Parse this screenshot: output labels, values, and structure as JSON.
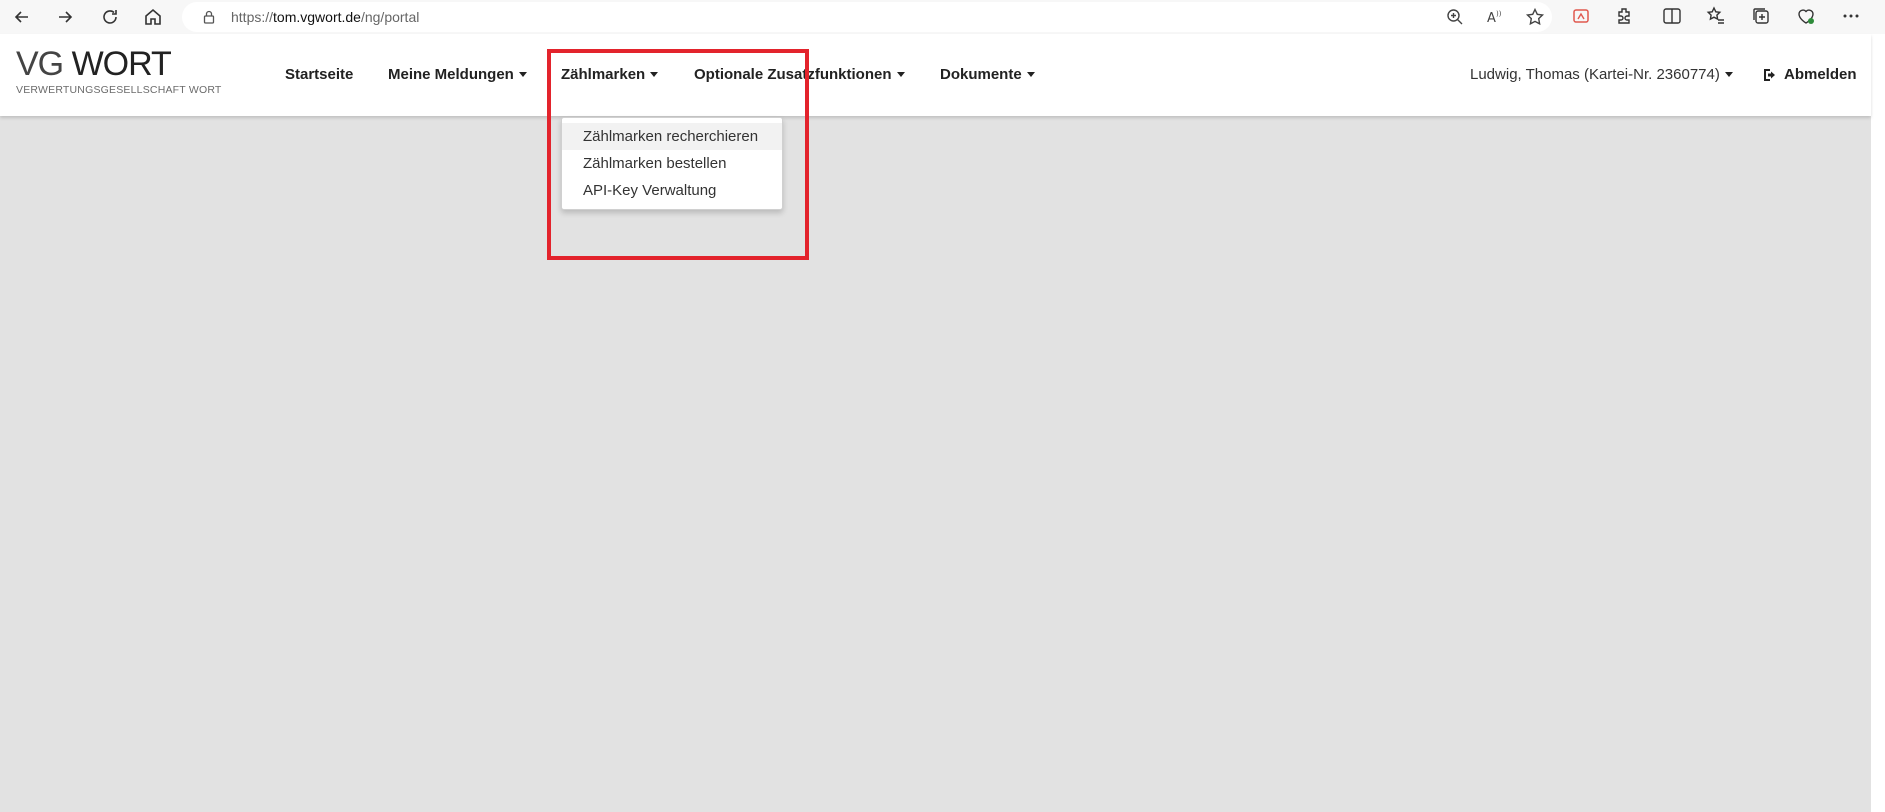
{
  "browser": {
    "url_scheme": "https://",
    "url_host": "tom.vgwort.de",
    "url_path": "/ng/portal",
    "back_icon": "arrow-left-icon",
    "forward_icon": "arrow-right-icon",
    "refresh_icon": "refresh-icon",
    "home_icon": "home-icon"
  },
  "logo": {
    "vg": "VG",
    "wort": "WORT",
    "subtitle": "VERWERTUNGSGESELLSCHAFT WORT"
  },
  "nav": {
    "startseite": "Startseite",
    "meine_meldungen": "Meine Meldungen",
    "zaehlmarken": "Zählmarken",
    "optionale": "Optionale Zusatzfunktionen",
    "dokumente": "Dokumente"
  },
  "user": {
    "label": "Ludwig, Thomas (Kartei-Nr. 2360774)",
    "logout": "Abmelden"
  },
  "dropdown": {
    "items": [
      {
        "label": "Zählmarken recherchieren"
      },
      {
        "label": "Zählmarken bestellen"
      },
      {
        "label": "API-Key Verwaltung"
      }
    ]
  },
  "colors": {
    "highlight": "#e3232c",
    "page_background": "#e2e2e2",
    "header_background": "#ffffff"
  }
}
